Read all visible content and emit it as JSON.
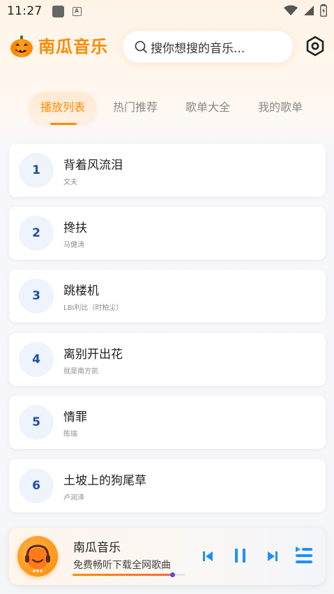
{
  "status": {
    "time": "11:27",
    "notif_letter": "A"
  },
  "header": {
    "app_title": "南瓜音乐",
    "search_placeholder": "搜你想搜的音乐...",
    "accent": "#ff8a00"
  },
  "tabs": [
    {
      "label": "播放列表",
      "active": true
    },
    {
      "label": "热门推荐",
      "active": false
    },
    {
      "label": "歌单大全",
      "active": false
    },
    {
      "label": "我的歌单",
      "active": false
    }
  ],
  "songs": [
    {
      "num": "1",
      "title": "背着风流泪",
      "artist": "文夫"
    },
    {
      "num": "2",
      "title": "搀扶",
      "artist": "马健涛"
    },
    {
      "num": "3",
      "title": "跳楼机",
      "artist": "LBI利比（时柏尘）"
    },
    {
      "num": "4",
      "title": "离别开出花",
      "artist": "就是南方凯"
    },
    {
      "num": "5",
      "title": "情罪",
      "artist": "陈瑞"
    },
    {
      "num": "6",
      "title": "土坡上的狗尾草",
      "artist": "卢润泽"
    }
  ],
  "player": {
    "title": "南瓜音乐",
    "subtitle": "免费畅听下载全网歌曲",
    "progress": 0.89
  }
}
